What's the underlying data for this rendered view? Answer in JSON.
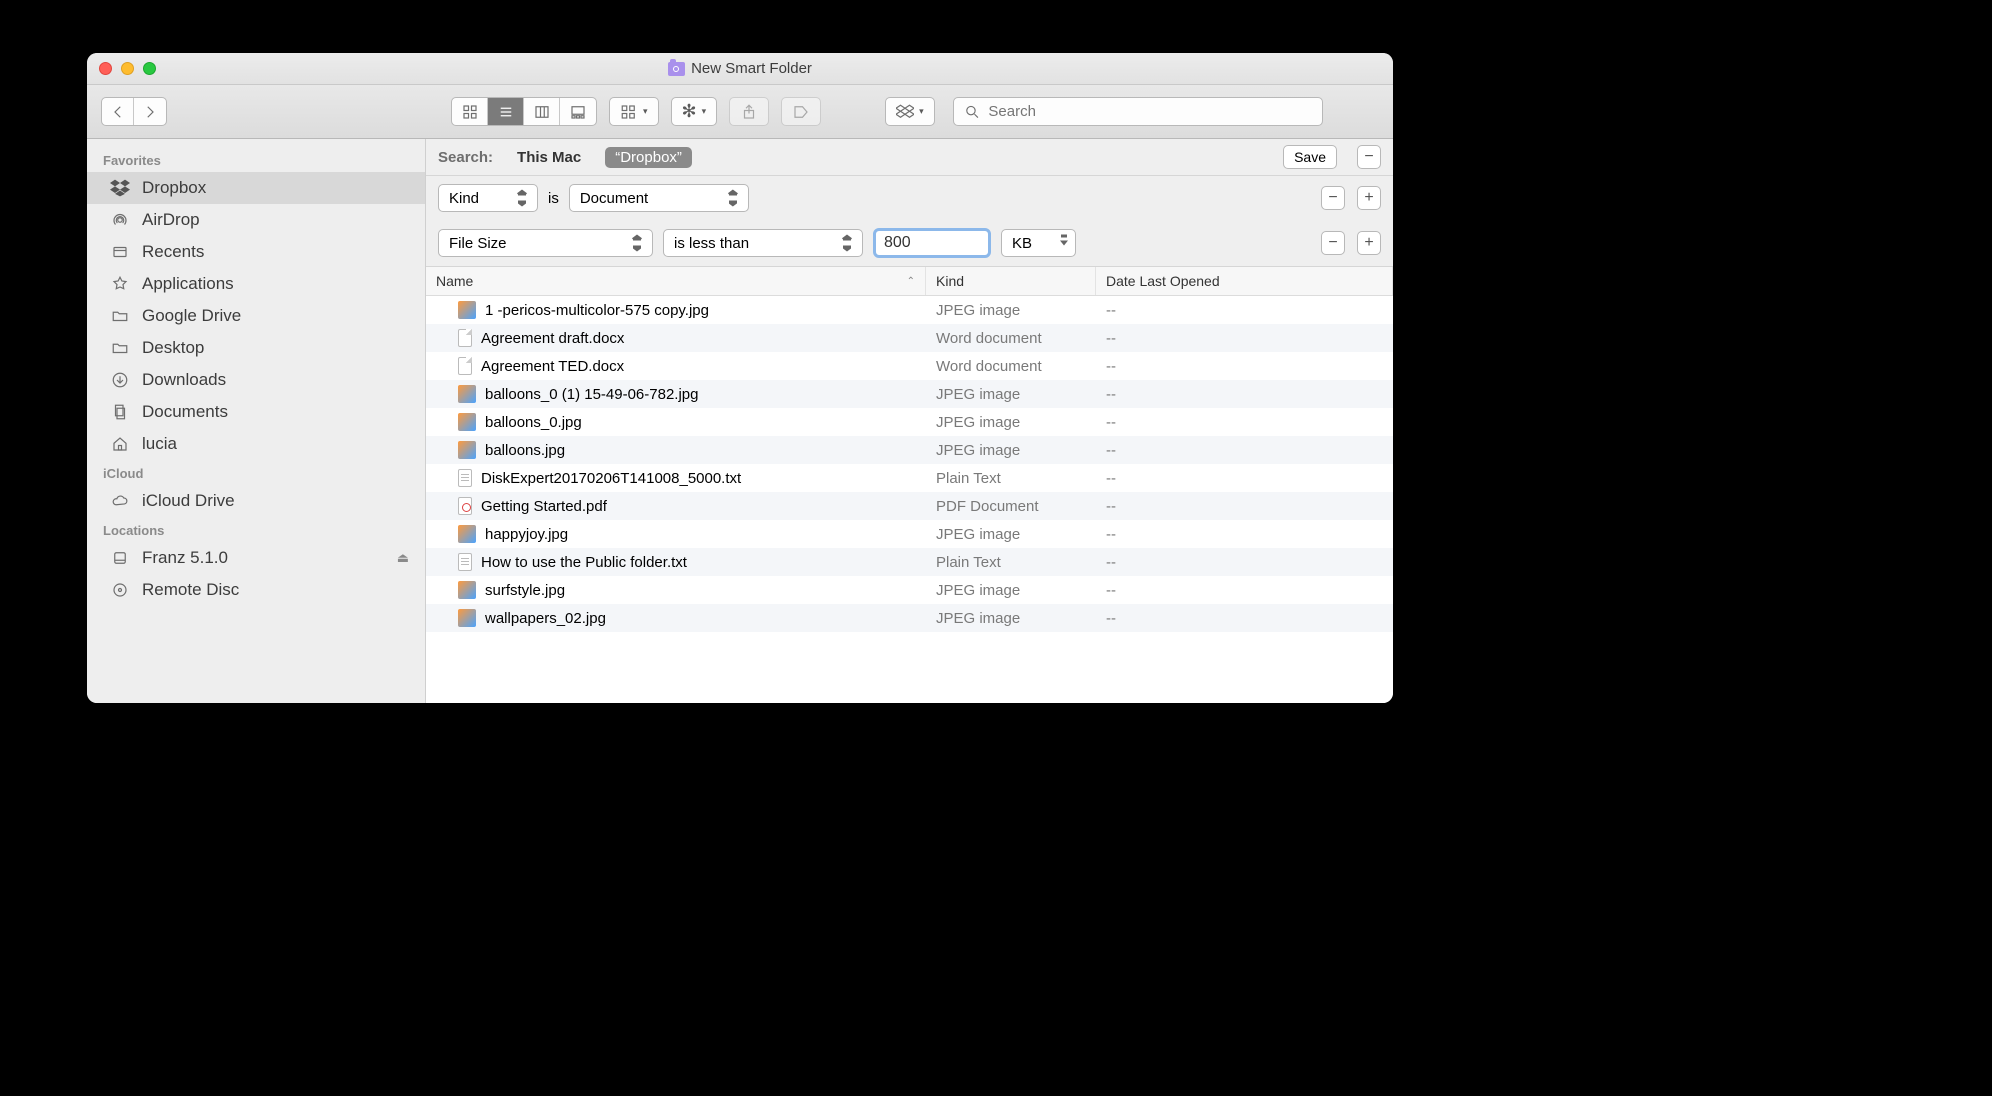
{
  "window": {
    "title": "New Smart Folder"
  },
  "toolbar": {
    "search_placeholder": "Search"
  },
  "sidebar": {
    "sections": [
      {
        "header": "Favorites",
        "items": [
          {
            "icon": "dropbox",
            "label": "Dropbox",
            "selected": true
          },
          {
            "icon": "airdrop",
            "label": "AirDrop"
          },
          {
            "icon": "recents",
            "label": "Recents"
          },
          {
            "icon": "apps",
            "label": "Applications"
          },
          {
            "icon": "folder",
            "label": "Google Drive"
          },
          {
            "icon": "folder",
            "label": "Desktop"
          },
          {
            "icon": "downloads",
            "label": "Downloads"
          },
          {
            "icon": "documents",
            "label": "Documents"
          },
          {
            "icon": "home",
            "label": "lucia"
          }
        ]
      },
      {
        "header": "iCloud",
        "items": [
          {
            "icon": "cloud",
            "label": "iCloud Drive"
          }
        ]
      },
      {
        "header": "Locations",
        "items": [
          {
            "icon": "disk",
            "label": "Franz 5.1.0",
            "eject": true
          },
          {
            "icon": "cd",
            "label": "Remote Disc"
          }
        ]
      }
    ]
  },
  "searchbar": {
    "label": "Search:",
    "scopes": [
      "This Mac",
      "“Dropbox”"
    ],
    "active_scope": 1,
    "save_label": "Save"
  },
  "criteria": [
    {
      "attr": "Kind",
      "op_text": "is",
      "value": "Document"
    },
    {
      "attr": "File Size",
      "op": "is less than",
      "num": "800",
      "unit": "KB"
    }
  ],
  "columns": {
    "name": "Name",
    "kind": "Kind",
    "date": "Date Last Opened"
  },
  "files": [
    {
      "icon": "jpeg",
      "name": "1 -pericos-multicolor-575 copy.jpg",
      "kind": "JPEG image",
      "date": "--"
    },
    {
      "icon": "doc",
      "name": "Agreement draft.docx",
      "kind": "Word document",
      "date": "--"
    },
    {
      "icon": "doc",
      "name": "Agreement TED.docx",
      "kind": "Word document",
      "date": "--"
    },
    {
      "icon": "jpeg",
      "name": "balloons_0 (1) 15-49-06-782.jpg",
      "kind": "JPEG image",
      "date": "--"
    },
    {
      "icon": "jpeg",
      "name": "balloons_0.jpg",
      "kind": "JPEG image",
      "date": "--"
    },
    {
      "icon": "jpeg",
      "name": "balloons.jpg",
      "kind": "JPEG image",
      "date": "--"
    },
    {
      "icon": "txt",
      "name": "DiskExpert20170206T141008_5000.txt",
      "kind": "Plain Text",
      "date": "--"
    },
    {
      "icon": "pdf",
      "name": "Getting Started.pdf",
      "kind": "PDF Document",
      "date": "--"
    },
    {
      "icon": "jpeg",
      "name": "happyjoy.jpg",
      "kind": "JPEG image",
      "date": "--"
    },
    {
      "icon": "txt",
      "name": "How to use the Public folder.txt",
      "kind": "Plain Text",
      "date": "--"
    },
    {
      "icon": "jpeg",
      "name": "surfstyle.jpg",
      "kind": "JPEG image",
      "date": "--"
    },
    {
      "icon": "jpeg",
      "name": "wallpapers_02.jpg",
      "kind": "JPEG image",
      "date": "--"
    }
  ]
}
